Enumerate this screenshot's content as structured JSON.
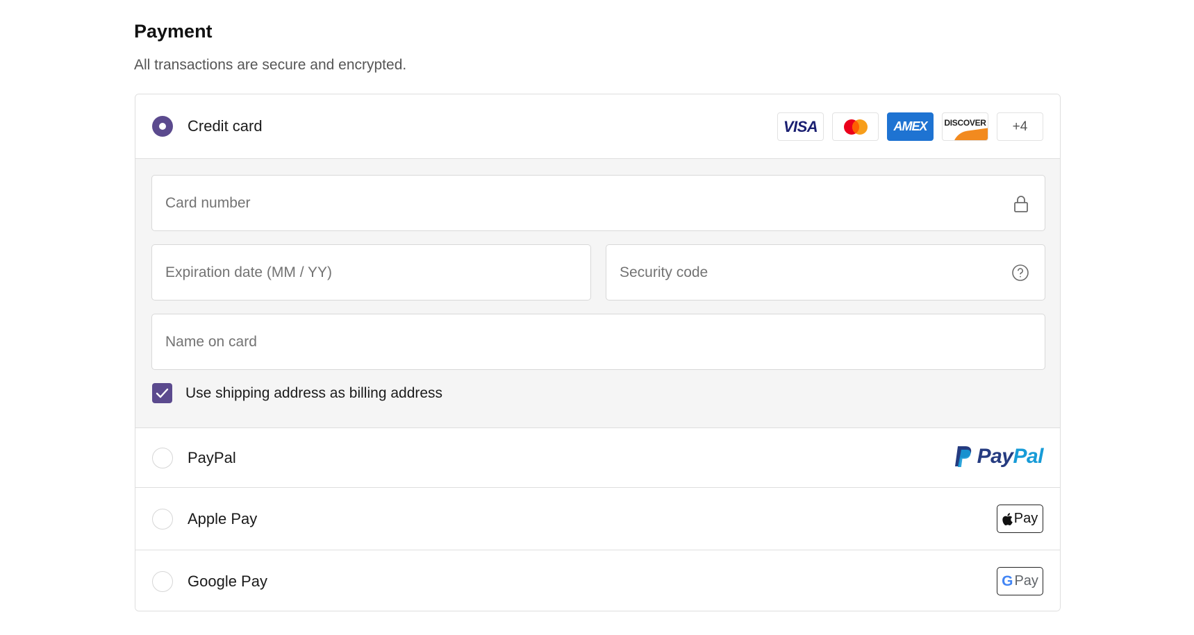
{
  "header": {
    "title": "Payment",
    "subtitle": "All transactions are secure and encrypted."
  },
  "options": {
    "credit_card": {
      "label": "Credit card",
      "selected": true,
      "brands": [
        "VISA",
        "AMEX",
        "DISCOVER",
        "+4"
      ],
      "brand_icons": [
        "visa-logo",
        "mastercard-logo",
        "amex-logo",
        "discover-logo"
      ]
    },
    "paypal": {
      "label": "PayPal",
      "selected": false,
      "logo_pay": "Pay",
      "logo_pal": "Pal"
    },
    "apple_pay": {
      "label": "Apple Pay",
      "selected": false,
      "badge_text": "Pay"
    },
    "google_pay": {
      "label": "Google Pay",
      "selected": false,
      "badge_g": "G",
      "badge_text": "Pay"
    }
  },
  "card_form": {
    "card_number": {
      "value": "",
      "placeholder": "Card number"
    },
    "expiration": {
      "value": "",
      "placeholder": "Expiration date (MM / YY)"
    },
    "security_code": {
      "value": "",
      "placeholder": "Security code"
    },
    "name_on_card": {
      "value": "",
      "placeholder": "Name on card"
    },
    "billing_same": {
      "label": "Use shipping address as billing address",
      "checked": true
    }
  },
  "colors": {
    "accent": "#5b4a8e",
    "amex_blue": "#1e73d2",
    "paypal_dark": "#253b80",
    "paypal_light": "#179bd7",
    "form_background": "#f5f5f5"
  }
}
